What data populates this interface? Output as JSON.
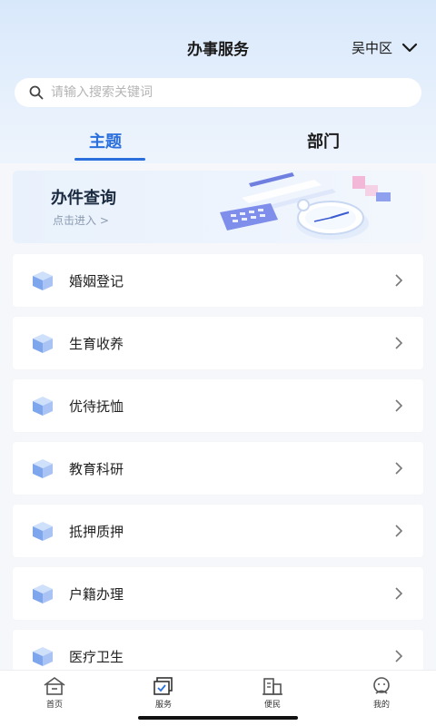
{
  "header": {
    "title": "办事服务",
    "region": "吴中区"
  },
  "search": {
    "placeholder": "请输入搜索关键词"
  },
  "tabs": [
    {
      "label": "主题",
      "active": true
    },
    {
      "label": "部门",
      "active": false
    }
  ],
  "banner": {
    "title": "办件查询",
    "subtitle": "点击进入 >"
  },
  "items": [
    {
      "label": "婚姻登记"
    },
    {
      "label": "生育收养"
    },
    {
      "label": "优待抚恤"
    },
    {
      "label": "教育科研"
    },
    {
      "label": "抵押质押"
    },
    {
      "label": "户籍办理"
    },
    {
      "label": "医疗卫生"
    }
  ],
  "bottom_nav": [
    {
      "label": "首页",
      "icon": "home-icon"
    },
    {
      "label": "服务",
      "icon": "service-icon"
    },
    {
      "label": "便民",
      "icon": "building-icon"
    },
    {
      "label": "我的",
      "icon": "profile-icon"
    }
  ],
  "colors": {
    "accent": "#2a6fdb",
    "header_bg": "#d8e8fb",
    "page_bg": "#f5f7fa"
  }
}
